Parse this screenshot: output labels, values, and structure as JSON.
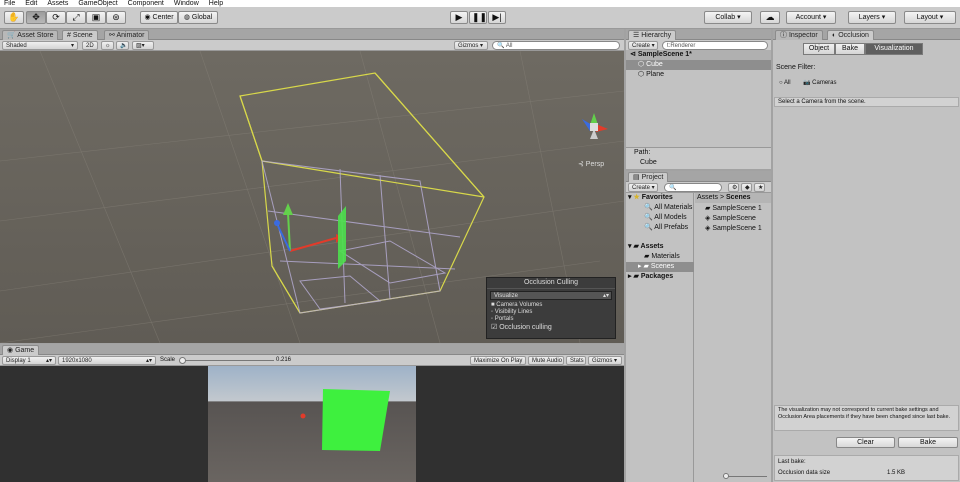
{
  "menu": [
    "File",
    "Edit",
    "Assets",
    "GameObject",
    "Component",
    "Window",
    "Help"
  ],
  "toolbar": {
    "center": "Center",
    "global": "Global",
    "collab": "Collab ▾",
    "account": "Account ▾",
    "layers": "Layers ▾",
    "layout": "Layout ▾"
  },
  "scene": {
    "tabs": [
      "Asset Store",
      "Scene",
      "Animator"
    ],
    "shading": "Shaded",
    "mode2d": "2D",
    "gizmos": "Gizmos ▾",
    "search": "All",
    "persp": "Persp"
  },
  "occlusion_overlay": {
    "title": "Occlusion Culling",
    "dropdown": "Visualize",
    "items": [
      "Camera Volumes",
      "Visibility Lines",
      "Portals"
    ],
    "toggle": "Occlusion culling"
  },
  "game": {
    "tab": "Game",
    "display": "Display 1",
    "resolution": "1920x1080",
    "scale_label": "Scale",
    "scale_value": "0.216",
    "maximize": "Maximize On Play",
    "mute": "Mute Audio",
    "stats": "Stats",
    "gizmos": "Gizmos ▾"
  },
  "hierarchy": {
    "tab": "Hierarchy",
    "create": "Create ▾",
    "search": "t:Renderer",
    "scene": "SampleScene 1*",
    "items": [
      "Cube",
      "Plane"
    ],
    "path_label": "Path:",
    "path_value": "Cube"
  },
  "project": {
    "tab": "Project",
    "create": "Create ▾",
    "favorites": "Favorites",
    "fav_items": [
      "All Materials",
      "All Models",
      "All Prefabs"
    ],
    "assets": "Assets",
    "asset_items": [
      "Materials",
      "Scenes"
    ],
    "packages": "Packages",
    "breadcrumb": [
      "Assets",
      ">",
      "Scenes"
    ],
    "files": [
      "SampleScene 1",
      "SampleScene",
      "SampleScene 1"
    ]
  },
  "inspector": {
    "tabs": [
      "Inspector",
      "Occlusion"
    ],
    "modes": [
      "Object",
      "Bake",
      "Visualization"
    ],
    "scene_filter": "Scene Filter:",
    "filter_all": "All",
    "filter_cameras": "Cameras",
    "help": "Select a Camera from the scene.",
    "warning": "The visualization may not correspond to current bake settings and Occlusion Area placements if they have been changed since last bake.",
    "clear": "Clear",
    "bake": "Bake",
    "last_bake": "Last bake:",
    "data_size_label": "Occlusion data size",
    "data_size_value": "1.5 KB"
  }
}
